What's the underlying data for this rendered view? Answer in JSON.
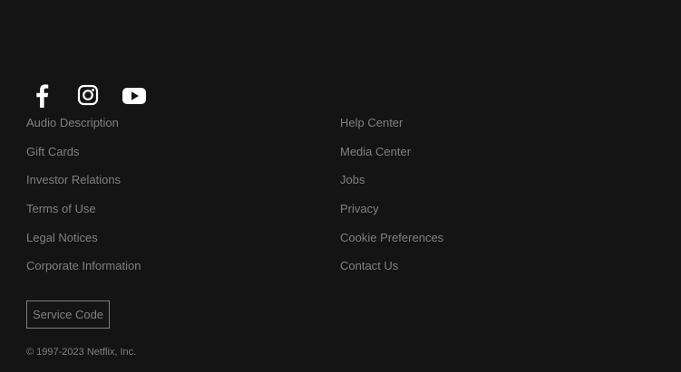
{
  "colors": {
    "background": "#141414",
    "text": "#808080",
    "icon": "#ffffff"
  },
  "social": [
    {
      "icon": "facebook-icon"
    },
    {
      "icon": "instagram-icon"
    },
    {
      "icon": "youtube-icon"
    }
  ],
  "links": {
    "left": [
      "Audio Description",
      "Gift Cards",
      "Investor Relations",
      "Terms of Use",
      "Legal Notices",
      "Corporate Information"
    ],
    "right": [
      "Help Center",
      "Media Center",
      "Jobs",
      "Privacy",
      "Cookie Preferences",
      "Contact Us"
    ]
  },
  "service_code_label": "Service Code",
  "copyright": "© 1997-2023 Netflix, Inc."
}
